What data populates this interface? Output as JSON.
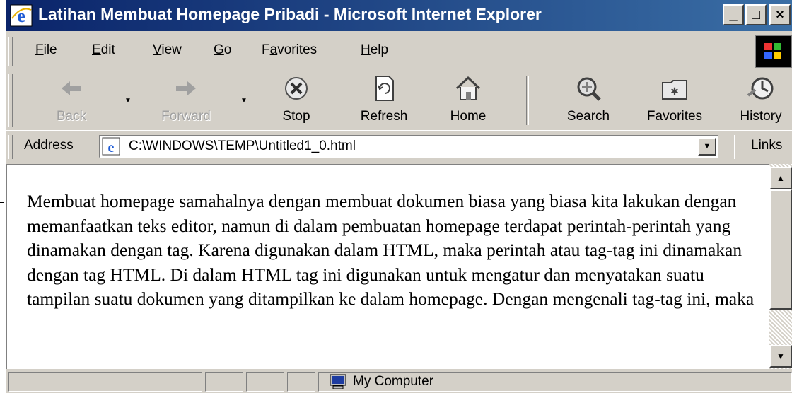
{
  "window": {
    "title": "Latihan Membuat Homepage Pribadi - Microsoft Internet Explorer",
    "controls": {
      "minimize": "_",
      "maximize": "□",
      "close": "×"
    }
  },
  "menu": {
    "items": [
      {
        "label": "File",
        "accel": "F"
      },
      {
        "label": "Edit",
        "accel": "E"
      },
      {
        "label": "View",
        "accel": "V"
      },
      {
        "label": "Go",
        "accel": "G"
      },
      {
        "label": "Favorites",
        "accel": "a"
      },
      {
        "label": "Help",
        "accel": "H"
      }
    ]
  },
  "toolbar": {
    "back": "Back",
    "forward": "Forward",
    "stop": "Stop",
    "refresh": "Refresh",
    "home": "Home",
    "search": "Search",
    "favorites": "Favorites",
    "history": "History"
  },
  "address": {
    "label": "Address",
    "value": "C:\\WINDOWS\\TEMP\\Untitled1_0.html",
    "links_label": "Links"
  },
  "content": {
    "paragraph": "Membuat homepage samahalnya dengan membuat dokumen biasa yang biasa kita lakukan dengan memanfaatkan teks editor, namun di dalam pembuatan homepage terdapat perintah-perintah yang dinamakan dengan tag. Karena digunakan dalam HTML, maka perintah atau tag-tag ini dinamakan dengan tag HTML. Di dalam HTML tag ini digunakan untuk mengatur dan menyatakan suatu tampilan suatu dokumen yang ditampilkan ke dalam homepage. Dengan mengenali tag-tag ini, maka"
  },
  "status": {
    "zone": "My Computer"
  },
  "colors": {
    "titlebar_start": "#0a246a",
    "titlebar_end": "#3a6ea5",
    "chrome": "#d4d0c8"
  }
}
